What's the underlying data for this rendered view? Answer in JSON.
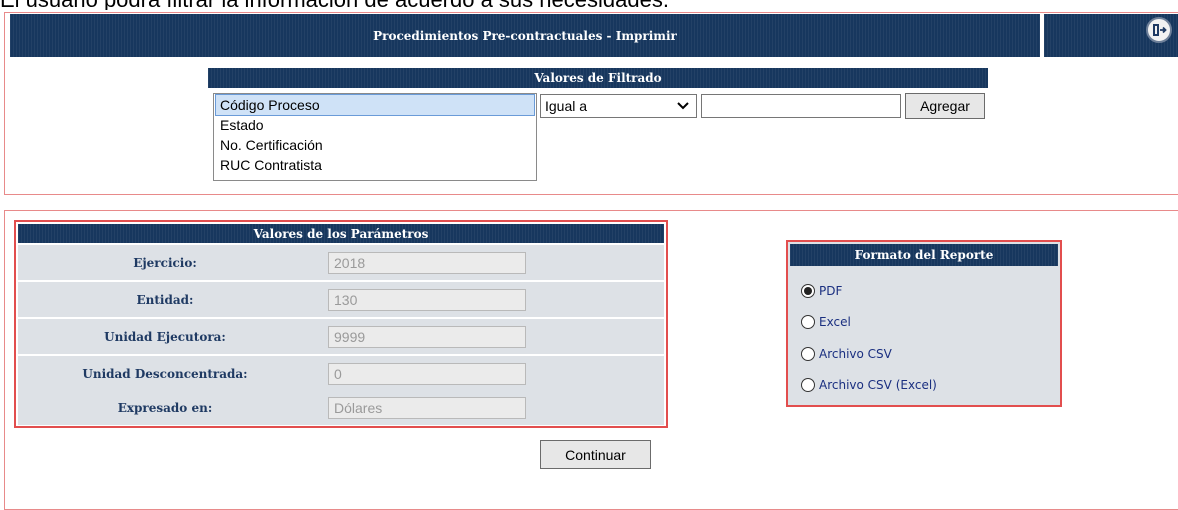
{
  "caption": "El usuario podrá filtrar la información de acuerdo a sus necesidades.",
  "header": {
    "title": "Procedimientos Pre-contractuales - Imprimir",
    "exit_icon": "exit-icon"
  },
  "filter": {
    "title": "Valores de Filtrado",
    "fields": [
      "Código Proceso",
      "Estado",
      "No. Certificación",
      "RUC Contratista"
    ],
    "selected_field": "Código Proceso",
    "condition": "Igual a",
    "value": "",
    "add_label": "Agregar"
  },
  "params": {
    "title": "Valores de los Parámetros",
    "rows": [
      {
        "label": "Ejercicio:",
        "value": "2018"
      },
      {
        "label": "Entidad:",
        "value": "130"
      },
      {
        "label": "Unidad Ejecutora:",
        "value": "9999"
      },
      {
        "label": "Unidad Desconcentrada:",
        "value": "0"
      },
      {
        "label": "Expresado en:",
        "value": "Dólares"
      }
    ]
  },
  "format": {
    "title": "Formato del Reporte",
    "options": [
      "PDF",
      "Excel",
      "Archivo CSV",
      "Archivo CSV (Excel)"
    ],
    "selected": "PDF"
  },
  "continue_label": "Continuar",
  "colors": {
    "header_bg": "#17375e",
    "panel_bg": "#dde1e6",
    "border_red": "#e24e4e",
    "label_blue": "#1f3a63"
  }
}
